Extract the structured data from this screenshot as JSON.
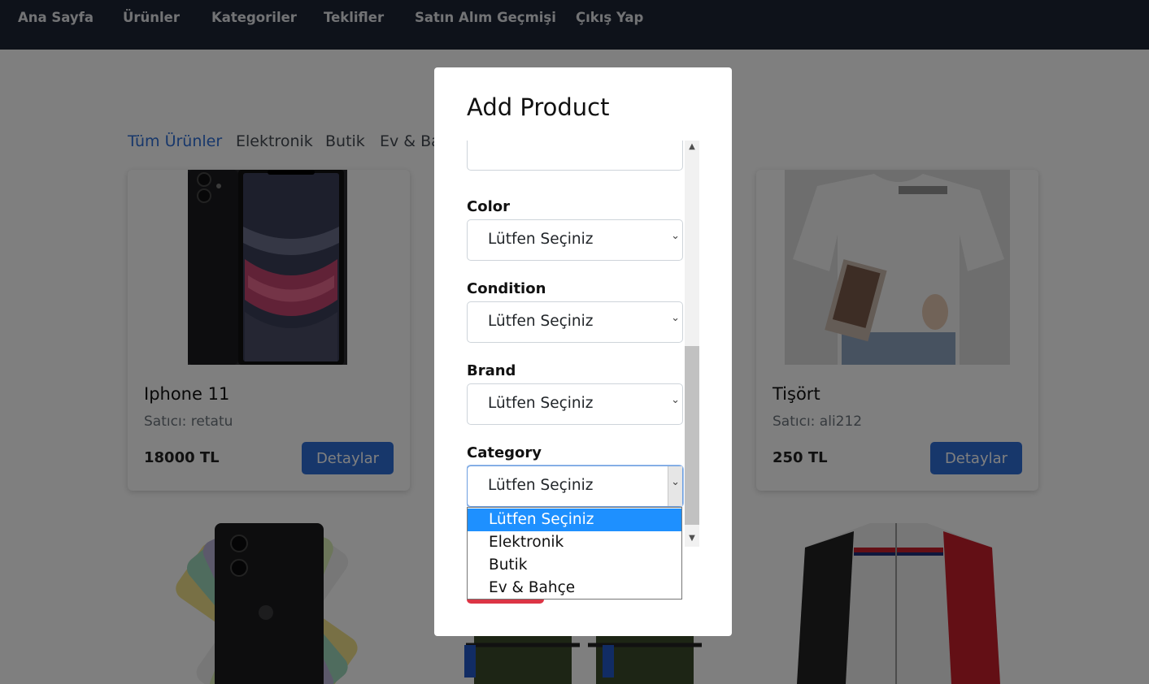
{
  "nav": {
    "items": [
      "Ana Sayfa",
      "Ürünler",
      "Kategoriler",
      "Teklifler",
      "Satın Alım Geçmişi",
      "Çıkış Yap"
    ]
  },
  "categories": {
    "tabs": [
      "Tüm Ürünler",
      "Elektronik",
      "Butik",
      "Ev & Ba"
    ],
    "active": "Tüm Ürünler"
  },
  "products": [
    {
      "title": "Iphone 11",
      "seller": "Satıcı: retatu",
      "price": "18000 TL",
      "button": "Detaylar"
    },
    {
      "title": "Tişört",
      "seller": "Satıcı: ali212",
      "price": "250 TL",
      "button": "Detaylar"
    }
  ],
  "modal": {
    "title": "Add Product",
    "fields": [
      {
        "label": "Color",
        "value": "Lütfen Seçiniz"
      },
      {
        "label": "Condition",
        "value": "Lütfen Seçiniz"
      },
      {
        "label": "Brand",
        "value": "Lütfen Seçiniz"
      },
      {
        "label": "Category",
        "value": "Lütfen Seçiniz"
      }
    ],
    "dropdown_options": [
      "Lütfen Seçiniz",
      "Elektronik",
      "Butik",
      "Ev & Bahçe"
    ],
    "dropdown_selected": "Lütfen Seçiniz"
  },
  "colors": {
    "navbar": "#1c2434",
    "accent": "#2f6fd6",
    "danger": "#dc3545",
    "dropdown_highlight": "#1e90ff"
  }
}
